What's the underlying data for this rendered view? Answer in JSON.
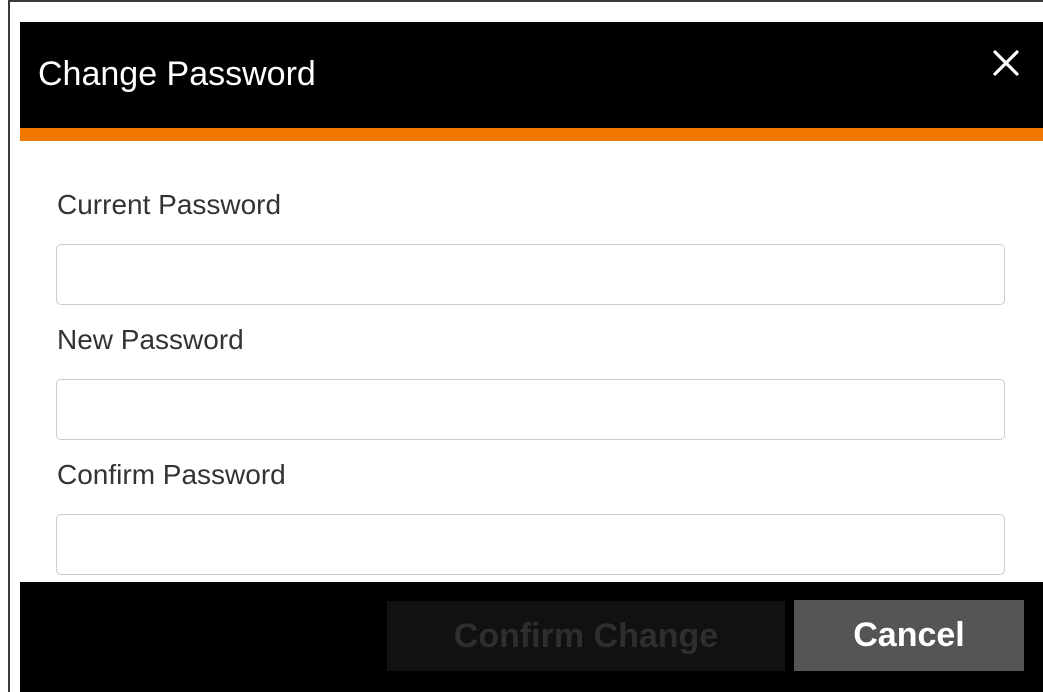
{
  "dialog": {
    "title": "Change Password",
    "close_icon": "close-icon",
    "accent_color": "#f07800",
    "header_color": "#000000"
  },
  "form": {
    "current_password": {
      "label": "Current Password",
      "value": "",
      "placeholder": ""
    },
    "new_password": {
      "label": "New Password",
      "value": "",
      "placeholder": ""
    },
    "confirm_password": {
      "label": "Confirm Password",
      "value": "",
      "placeholder": ""
    }
  },
  "footer": {
    "confirm_label": "Confirm Change",
    "confirm_state": "disabled",
    "cancel_label": "Cancel"
  }
}
